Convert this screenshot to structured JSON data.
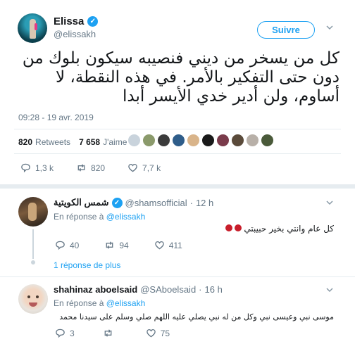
{
  "main_tweet": {
    "author_name": "Elissa",
    "author_handle": "@elissakh",
    "follow_label": "Suivre",
    "text": "كل من يسخر من ديني فنصيبه سيكون بلوك من دون حتى التفكير بالأمر. في هذه النقطة، لا أساوم، ولن أدير خدي الأيسر أبدا",
    "timestamp": "09:28 - 19 avr. 2019",
    "retweets_count": "820",
    "retweets_label": "Retweets",
    "likes_count": "7 658",
    "likes_label": "J'aime",
    "actions": {
      "replies": "1,3 k",
      "retweets": "820",
      "likes": "7,7 k"
    }
  },
  "likers_colors": [
    "#c9d3dc",
    "#8b9a6b",
    "#3b3b3b",
    "#2f5d8a",
    "#d9b48a",
    "#1a1a1a",
    "#7a3b4b",
    "#5a4a3a",
    "#b8b0a8",
    "#4a5a3a"
  ],
  "replies": [
    {
      "author_name": "شمس الكويتية",
      "author_handle": "@shamsofficial",
      "time": "12 h",
      "in_reply_prefix": "En réponse à",
      "in_reply_to": "@elissakh",
      "text": "كل عام وانتي بخير حبيبتي",
      "actions": {
        "replies": "40",
        "retweets": "94",
        "likes": "411"
      },
      "more_label": "1 réponse de plus"
    },
    {
      "author_name": "shahinaz aboelsaid",
      "author_handle": "@SAboelsaid",
      "time": "16 h",
      "in_reply_prefix": "En réponse à",
      "in_reply_to": "@elissakh",
      "text": "موسى نبي وعيسى نبي وكل من له نبي يصلي عليه   اللهم صلي وسلم على سيدنا محمد",
      "actions": {
        "replies": "3",
        "retweets": "",
        "likes": "75"
      }
    }
  ],
  "colors": {
    "accent": "#1da1f2",
    "muted": "#657786",
    "divider": "#e6ecf0"
  }
}
